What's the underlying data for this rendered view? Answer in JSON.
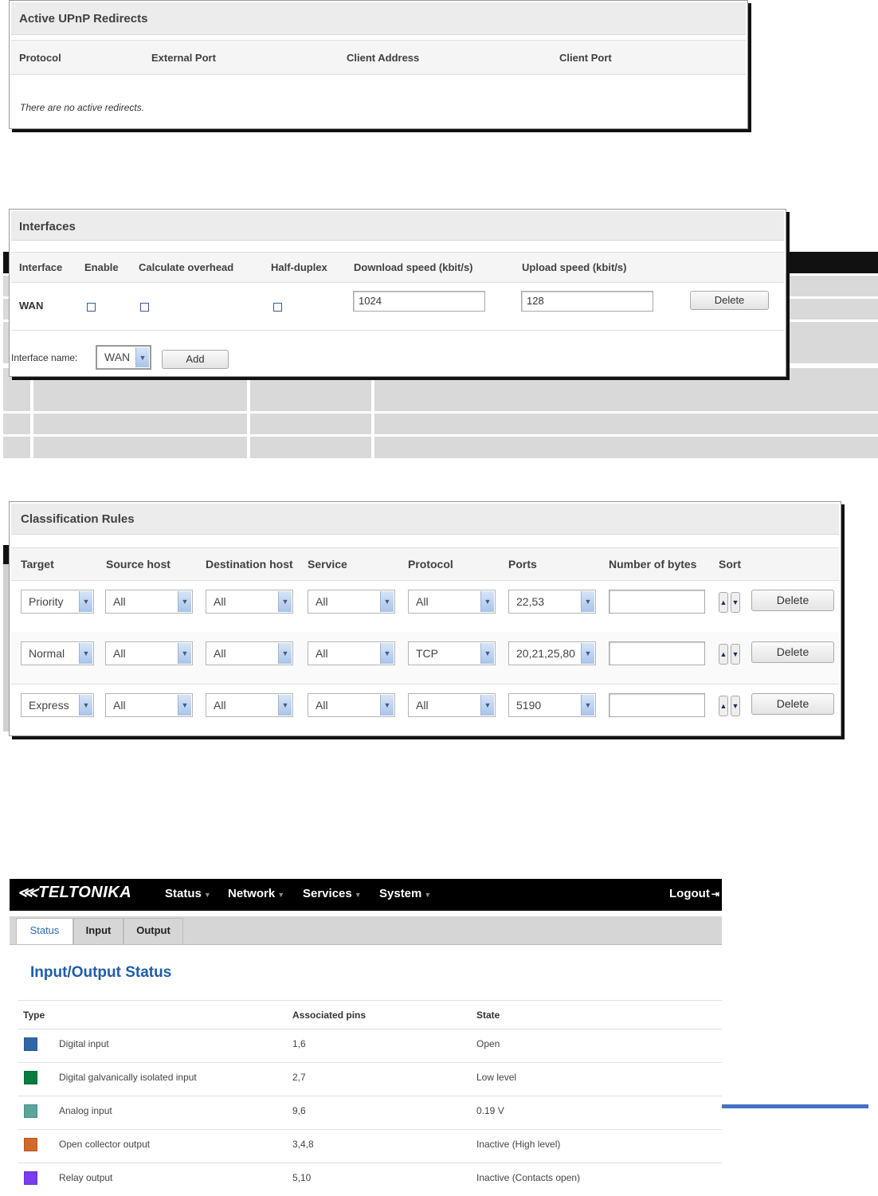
{
  "upnp": {
    "title": "Active UPnP Redirects",
    "columns": [
      "Protocol",
      "External Port",
      "Client Address",
      "Client Port"
    ],
    "empty_message": "There are no active redirects."
  },
  "interfaces": {
    "title": "Interfaces",
    "columns": [
      "Interface",
      "Enable",
      "Calculate overhead",
      "Half-duplex",
      "Download speed (kbit/s)",
      "Upload speed (kbit/s)"
    ],
    "row": {
      "interface": "WAN",
      "download": "1024",
      "upload": "128",
      "delete_label": "Delete"
    },
    "interface_name_label": "Interface name:",
    "interface_name_value": "WAN",
    "add_label": "Add"
  },
  "classification": {
    "title": "Classification Rules",
    "columns": [
      "Target",
      "Source host",
      "Destination host",
      "Service",
      "Protocol",
      "Ports",
      "Number of bytes",
      "Sort"
    ],
    "rows": [
      {
        "target": "Priority",
        "source": "All",
        "destination": "All",
        "service": "All",
        "protocol": "All",
        "ports": "22,53",
        "bytes": "",
        "delete": "Delete"
      },
      {
        "target": "Normal",
        "source": "All",
        "destination": "All",
        "service": "All",
        "protocol": "TCP",
        "ports": "20,21,25,80",
        "bytes": "",
        "delete": "Delete"
      },
      {
        "target": "Express",
        "source": "All",
        "destination": "All",
        "service": "All",
        "protocol": "All",
        "ports": "5190",
        "bytes": "",
        "delete": "Delete"
      }
    ]
  },
  "teltonika": {
    "logo": "TELTONIKA",
    "nav": [
      "Status",
      "Network",
      "Services",
      "System"
    ],
    "logout": "Logout",
    "tabs": [
      "Status",
      "Input",
      "Output"
    ],
    "page_title": "Input/Output Status",
    "columns": [
      "Type",
      "Associated pins",
      "State"
    ],
    "rows": [
      {
        "type": "Digital input",
        "pins": "1,6",
        "state": "Open",
        "color": "#2f67a8"
      },
      {
        "type": "Digital galvanically isolated input",
        "pins": "2,7",
        "state": "Low level",
        "color": "#0b7a3e"
      },
      {
        "type": "Analog input",
        "pins": "9,6",
        "state": "0.19 V",
        "color": "#5aa59b"
      },
      {
        "type": "Open collector output",
        "pins": "3,4,8",
        "state": "Inactive (High level)",
        "color": "#d2682a"
      },
      {
        "type": "Relay output",
        "pins": "5,10",
        "state": "Inactive (Contacts open)",
        "color": "#7a3cf0"
      }
    ],
    "accent": "#4472c4"
  }
}
